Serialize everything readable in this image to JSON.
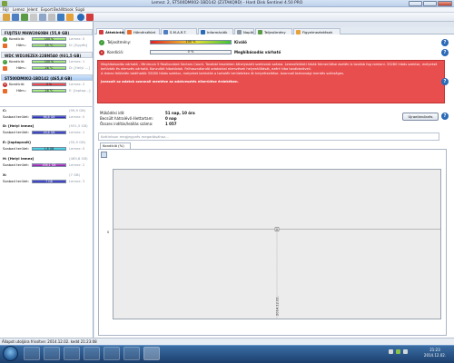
{
  "window": {
    "title": "Lemez: 2, ST500DM002-1BD142 (Z3TAKQ9D) - Hard Disk Sentinel 4.50 PRO"
  },
  "menubar": [
    "Fájl",
    "Lemez",
    "Jelent",
    "Export",
    "Beállítások",
    "Súgó"
  ],
  "sidebar": {
    "disks": [
      {
        "name": "FUJITSU MHW2060BH",
        "size": "(55,9 GB)",
        "kondicio_label": "Kondíció:",
        "kondicio_value": "100 %",
        "kondicio_sub": "Lemez: 0",
        "homer_label": "Hőm.:",
        "homer_value": "35 °C",
        "homer_sub": "D: [Egyéb]",
        "status": "ok"
      },
      {
        "name": "WDC WD10EZEX-22BN5A0",
        "size": "(931,5 GB)",
        "kondicio_label": "Kondíció:",
        "kondicio_value": "100 %",
        "kondicio_sub": "Lemez: 1",
        "homer_label": "Hőm.:",
        "homer_value": "26 °C",
        "homer_sub": "D: [Helyi ...]",
        "status": "ok"
      },
      {
        "name": "ST500DM002-1BD142",
        "size": "(465,8 GB)",
        "kondicio_label": "Kondíció:",
        "kondicio_value": "0 %",
        "kondicio_sub": "Lemez: 2",
        "homer_label": "Hőm.:",
        "homer_value": "28 °C",
        "homer_sub": "E: [laptop...]",
        "status": "bad"
      }
    ],
    "volumes": [
      {
        "name": "C:",
        "size": "(99,9 GB)",
        "free_label": "Szabad terület:",
        "free_value": "66,8 GB",
        "disk": "Lemez: 0",
        "color": "blue"
      },
      {
        "name": "D: [Helyi lemez]",
        "size": "(931,5 GB)",
        "free_label": "Szabad terület:",
        "free_value": "49,6 GB",
        "disk": "Lemez: 1",
        "color": "blue"
      },
      {
        "name": "E: [laptopvolt]",
        "size": "(55,9 GB)",
        "free_label": "Szabad terület:",
        "free_value": "1,6 GB",
        "disk": "Lemez: 0",
        "color": "cyan"
      },
      {
        "name": "H: [Helyi lemez]",
        "size": "(465,8 GB)",
        "free_label": "Szabad terület:",
        "free_value": "456,1 GB",
        "disk": "Lemez: 2",
        "color": "purple"
      },
      {
        "name": "X:",
        "size": "(7 GB)",
        "free_label": "Szabad terület:",
        "free_value": "7 GB",
        "disk": "Lemez: 3",
        "color": "blue"
      }
    ]
  },
  "tabs": [
    "Áttekintés",
    "Hőmérséklet",
    "S.M.A.R.T.",
    "Információk",
    "Napló",
    "Teljesítmény",
    "Figyelmeztetések"
  ],
  "overview": {
    "teljesitmeny_label": "Teljesítmény:",
    "teljesitmeny_value": "100 %",
    "teljesitmeny_status": "Kiváló",
    "teljesitmeny_percent": 100,
    "kondicio_label": "Kondíció:",
    "kondicio_value": "0 %",
    "kondicio_status": "Meghibásodás várható",
    "kondicio_percent": 0
  },
  "alert": {
    "text": "Meghibásodás várható - Minimum 5 Reallocated Sectors Count. További teszteken áthelyezett szektorok száma. Lemezfelületi hibák felmerülése esetén is tovább fog romlani. 33280 hibás szektor, melyeket behívták és elemzés várható. Konzultál hibakódok. Felhasználandó adatokkal elemzések helyreállítását, ezért hiba továbbnöveli.",
    "text2": "A lemez felületén találhatók 33280 hibás szektor, melyeket behívták a tartalék területeken át helyettesítése. Azonnali biztonsági mentés szükséges.",
    "highlight": "Javasolt az adatok azonnali mentése az adatvesztés elkerülése érdekében."
  },
  "stats": [
    {
      "label": "Működési idő:",
      "value": "51 nap, 10 óra"
    },
    {
      "label": "Becsült hátralévő élettartam:",
      "value": "0 nap"
    },
    {
      "label": "Összes indítás/leállás száma:",
      "value": "1 057"
    }
  ],
  "refresh_button": "Újraellenőrzés",
  "comment_placeholder": "Kattintson megjegyzés megadásához...",
  "chart_tab": "Kondíció  (%)",
  "chart_data": {
    "type": "line",
    "x": [
      "2014.12.02."
    ],
    "series": [
      {
        "values": [
          0
        ]
      }
    ],
    "point_label": "0",
    "ylabel": "",
    "xlabel": ""
  },
  "statusbar": "Állapot utoljára frissítve: 2014.12.02. kedd 21:23:08",
  "taskbar": {
    "time": "21:23",
    "date": "2014.12.02."
  }
}
